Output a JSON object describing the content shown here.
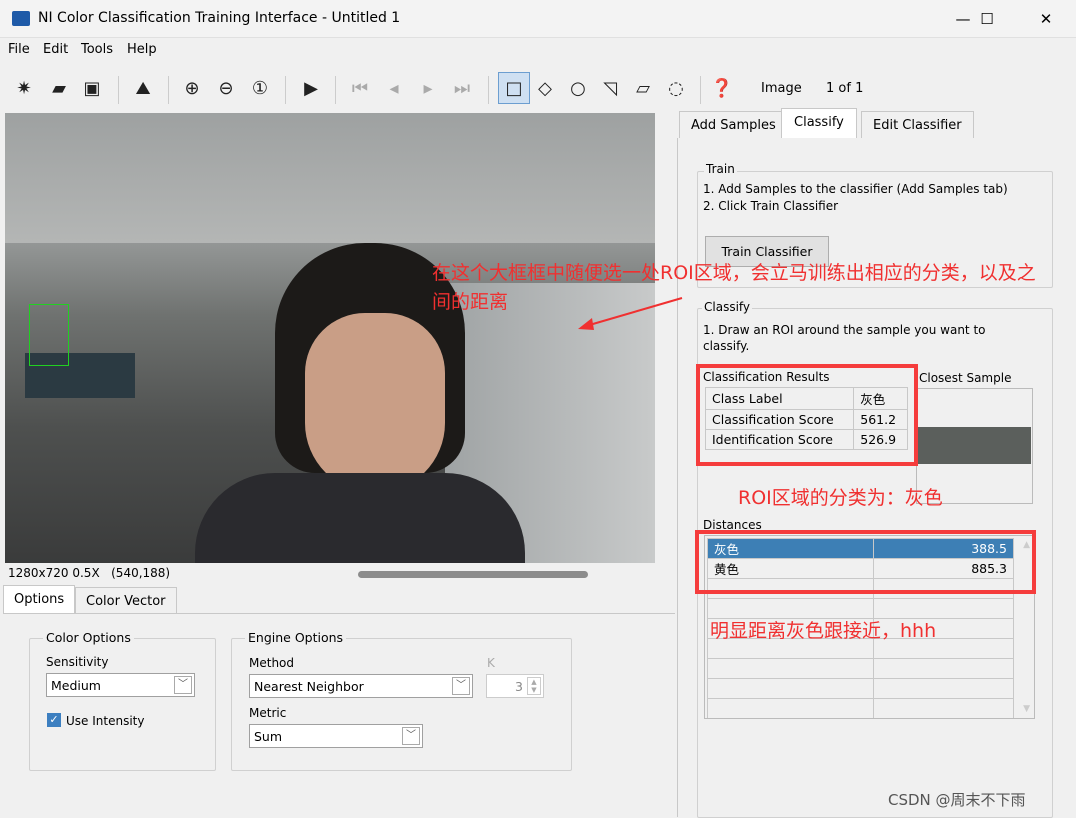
{
  "window": {
    "title": "NI Color Classification Training Interface - Untitled 1",
    "minimize": "—",
    "maximize": "☐",
    "close": "✕"
  },
  "menu": [
    "File",
    "Edit",
    "Tools",
    "Help"
  ],
  "toolbar": {
    "image_label": "Image",
    "page": "1 of 1"
  },
  "status": {
    "resolution": "1280x720 0.5X",
    "coords": "(540,188)"
  },
  "bottom_tabs": [
    "Options",
    "Color Vector"
  ],
  "color_options": {
    "title": "Color Options",
    "sensitivity_label": "Sensitivity",
    "sensitivity": "Medium",
    "use_intensity": "Use Intensity",
    "use_intensity_checked": true
  },
  "engine_options": {
    "title": "Engine Options",
    "method_label": "Method",
    "method": "Nearest Neighbor",
    "k_label": "K",
    "k": "3",
    "metric_label": "Metric",
    "metric": "Sum"
  },
  "right_tabs": [
    "Add Samples",
    "Classify",
    "Edit Classifier"
  ],
  "train": {
    "title": "Train",
    "step1": "1. Add Samples to the classifier (Add Samples tab)",
    "step2": "2. Click Train Classifier",
    "button": "Train Classifier"
  },
  "classify": {
    "title": "Classify",
    "instruction": "1. Draw an ROI around the sample you want to classify.",
    "results_title": "Classification Results",
    "results": [
      {
        "k": "Class Label",
        "v": "灰色"
      },
      {
        "k": "Classification Score",
        "v": "561.2"
      },
      {
        "k": "Identification Score",
        "v": "526.9"
      }
    ],
    "closest_sample": "Closest Sample",
    "closest_color": "#5b5f5c",
    "distances_title": "Distances",
    "distances": [
      {
        "label": "灰色",
        "value": "388.5"
      },
      {
        "label": "黄色",
        "value": "885.3"
      }
    ]
  },
  "annotations": {
    "a1": "在这个大框框中随便选一处ROI区域，会立马训练出相应的分类，以及之间的距离",
    "a2": "ROI区域的分类为：灰色",
    "a3": "明显距离灰色跟接近，hhh"
  },
  "watermark": "CSDN @周末不下雨",
  "colors": {
    "annotation": "#f03030",
    "selection": "#3d7fb5"
  }
}
